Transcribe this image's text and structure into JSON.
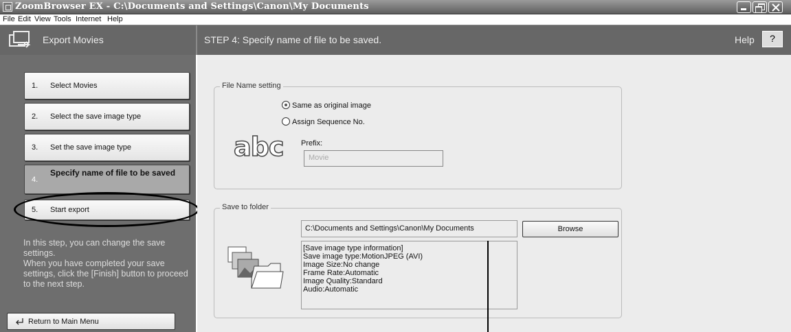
{
  "window": {
    "title": "ZoomBrowser EX  -  C:\\Documents and Settings\\Canon\\My Documents"
  },
  "menu": [
    "File",
    "Edit",
    "View",
    "Tools",
    "Internet",
    "Help"
  ],
  "header": {
    "left_title": "Export Movies",
    "step_title": "STEP 4: Specify name of file to be saved.",
    "help_label": "Help",
    "help_button": "?"
  },
  "steps": [
    {
      "num": "1.",
      "label": "Select Movies"
    },
    {
      "num": "2.",
      "label": "Select the save image type"
    },
    {
      "num": "3.",
      "label": "Set the save image type"
    },
    {
      "num": "4.",
      "label": "Specify name of file to be saved"
    },
    {
      "num": "5.",
      "label": "Start export"
    }
  ],
  "sidebar": {
    "description": "In this step, you can change the save settings.\n When you have completed your save settings, click the [Finish] button to proceed to the next step.",
    "return_label": "Return to Main Menu"
  },
  "file_name": {
    "legend": "File Name setting",
    "option_same": "Same as original image",
    "option_seq": "Assign Sequence No.",
    "selected": "Same as original image",
    "abc_text": "abc",
    "prefix_label": "Prefix:",
    "prefix_value": "Movie"
  },
  "save_folder": {
    "legend": "Save to folder",
    "path": "C:\\Documents and Settings\\Canon\\My Documents",
    "browse_label": "Browse",
    "info_lines": [
      "[Save image type information]",
      "Save image type:MotionJPEG (AVI)",
      "Image Size:No change",
      "Frame Rate:Automatic",
      "Image Quality:Standard",
      "Audio:Automatic"
    ]
  }
}
